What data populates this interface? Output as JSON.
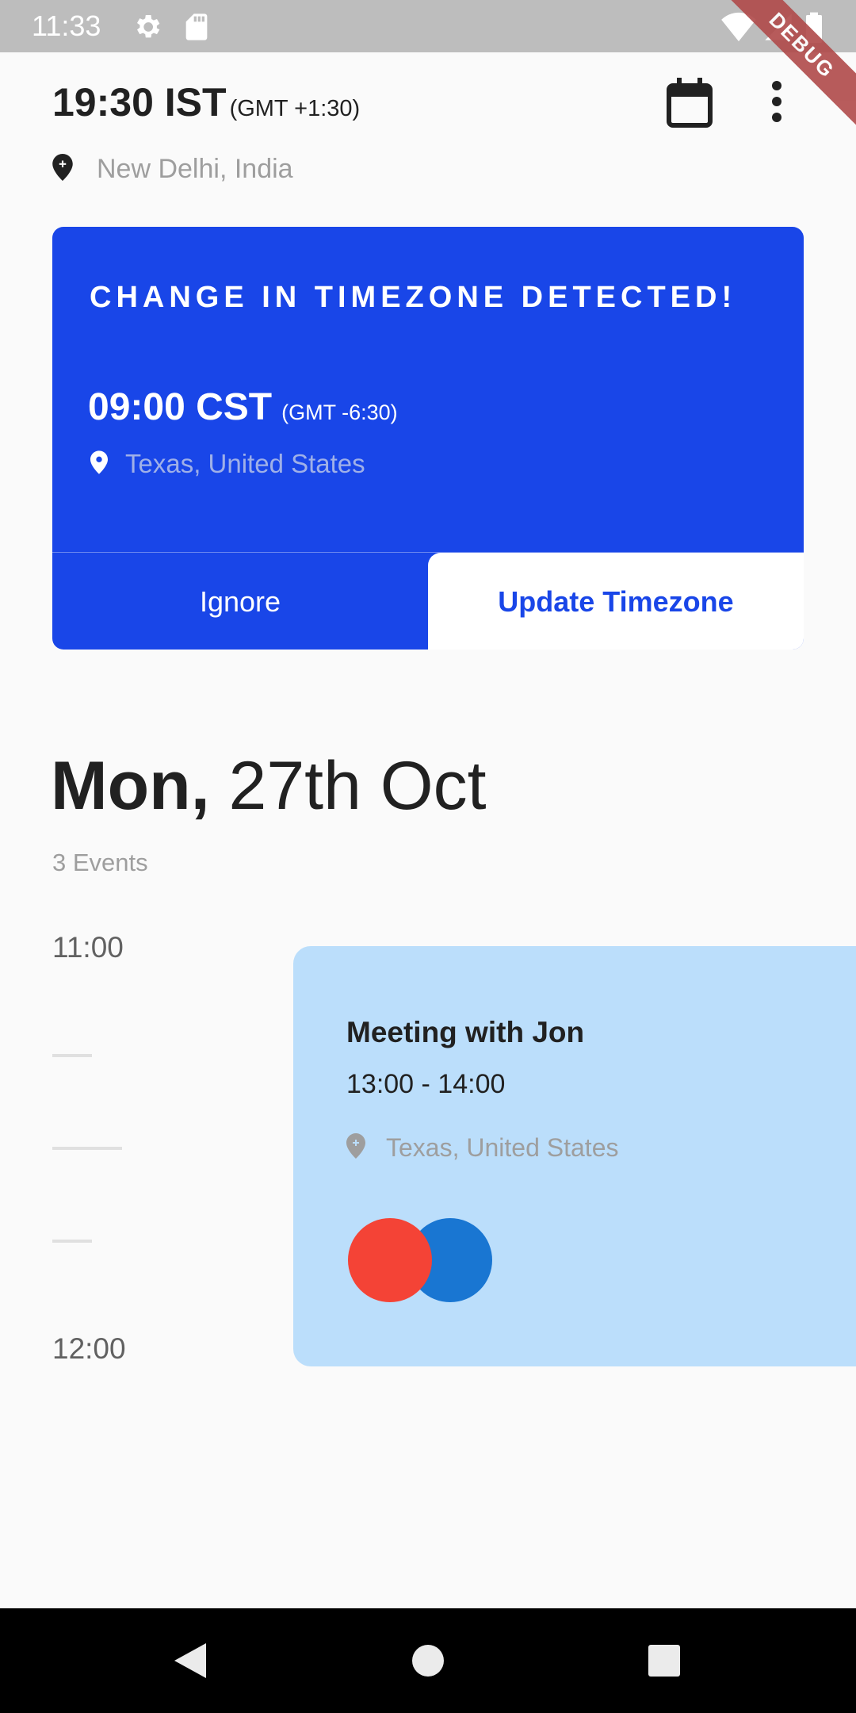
{
  "status_bar": {
    "time": "11:33",
    "icons": [
      "settings-icon",
      "sd-card-icon",
      "wifi-icon",
      "signal-icon",
      "battery-icon"
    ],
    "debug_banner": "DEBUG"
  },
  "header": {
    "time": "19:30 IST",
    "gmt_offset": "(GMT +1:30)",
    "location": "New Delhi, India",
    "actions": [
      "calendar-icon",
      "more-vert-icon"
    ]
  },
  "timezone_alert": {
    "title": "CHANGE IN TIMEZONE DETECTED!",
    "time": "09:00 CST",
    "gmt_offset": "(GMT -6:30)",
    "location": "Texas, United States",
    "ignore_label": "Ignore",
    "update_label": "Update Timezone",
    "background_color": "#1946e8"
  },
  "date": {
    "day": "Mon,",
    "date": "27th Oct",
    "events_count": "3 Events"
  },
  "timeline": {
    "hours": [
      "11:00",
      "12:00"
    ]
  },
  "event": {
    "title": "Meeting with Jon",
    "time": "13:00 - 14:00",
    "location": "Texas, United States",
    "background_color": "#bbdefb",
    "attendee_colors": [
      "#f44336",
      "#1976d2"
    ]
  },
  "nav_bar": {
    "buttons": [
      "back-icon",
      "home-icon",
      "recents-icon"
    ]
  }
}
